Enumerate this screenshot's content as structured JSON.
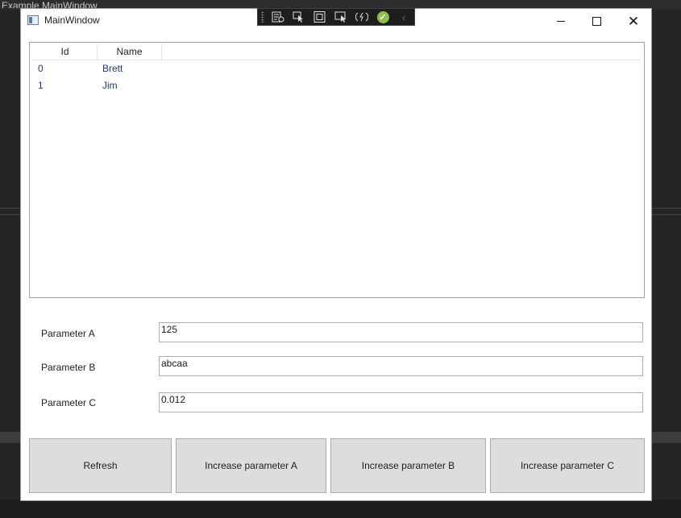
{
  "backdrop": {
    "title": "Example MainWindow"
  },
  "window": {
    "title": "MainWindow",
    "close_glyph": "✕"
  },
  "designer_toolbar": {
    "check_glyph": "✓",
    "collapse_glyph": "‹"
  },
  "list": {
    "columns": [
      "Id",
      "Name"
    ],
    "rows": [
      {
        "id": "0",
        "name": "Brett"
      },
      {
        "id": "1",
        "name": "Jim"
      }
    ]
  },
  "params": [
    {
      "label": "Parameter A",
      "value": "125"
    },
    {
      "label": "Parameter B",
      "value": "abcaa"
    },
    {
      "label": "Parameter C",
      "value": "0.012"
    }
  ],
  "buttons": {
    "refresh": "Refresh",
    "increase_a": "Increase parameter A",
    "increase_b": "Increase parameter B",
    "increase_c": "Increase parameter C"
  },
  "colors": {
    "list_text": "#1a3a8a",
    "button_bg": "#dddddd",
    "status_ok": "#8bc34a"
  }
}
